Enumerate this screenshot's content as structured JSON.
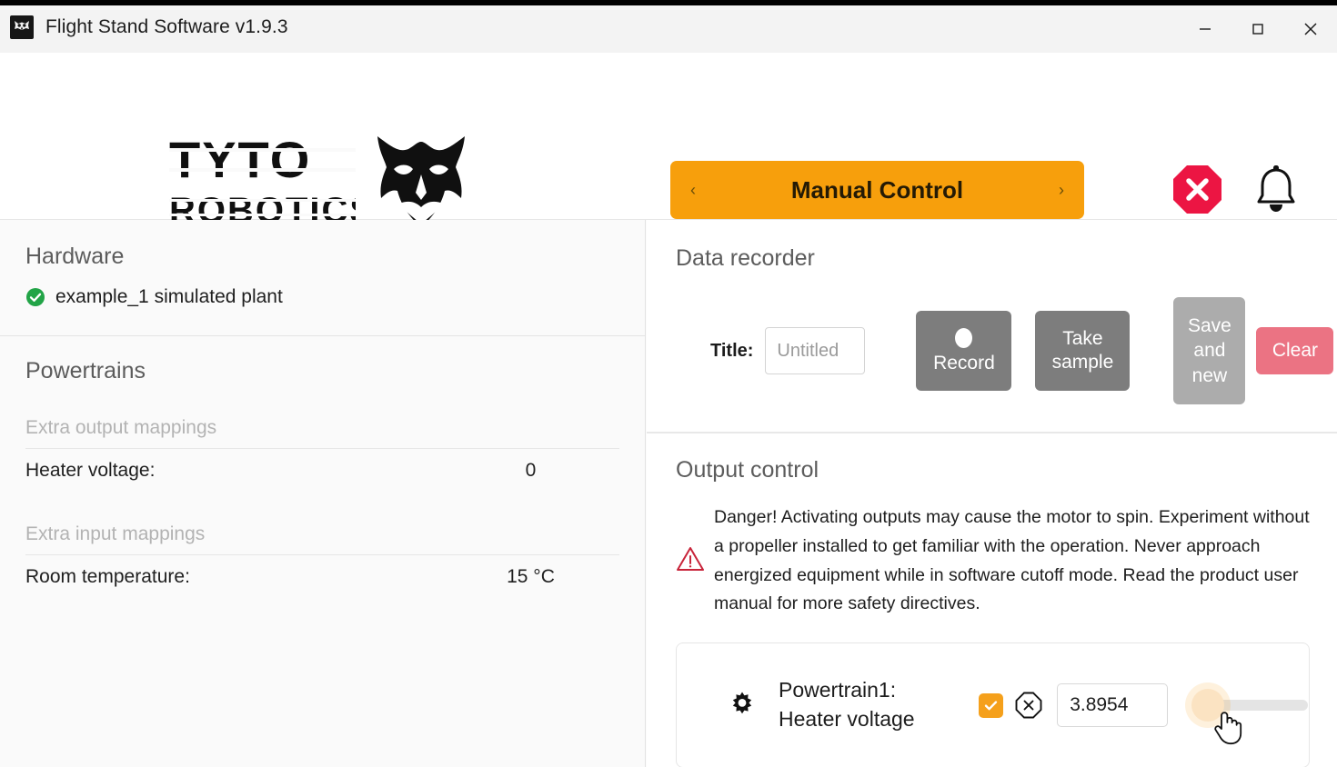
{
  "window": {
    "title": "Flight Stand Software v1.9.3",
    "app_icon": "owl-app-icon",
    "minimize_label": "Minimize",
    "maximize_label": "Maximize",
    "close_label": "Close"
  },
  "header": {
    "brand_line1": "TYTO",
    "brand_line2": "ROBOTICS",
    "brand_mark": "owl-logo",
    "mode": {
      "label": "Manual Control",
      "prev": "‹",
      "next": "›",
      "color": "#f79f0c"
    },
    "stop_button": {
      "name": "emergency-stop",
      "color": "#ec1543"
    },
    "bell_button": {
      "name": "notifications"
    }
  },
  "sidebar": {
    "hardware": {
      "title": "Hardware",
      "device": "example_1 simulated plant",
      "status_color": "#22a447"
    },
    "powertrains": {
      "title": "Powertrains",
      "groups": [
        {
          "title": "Extra output mappings",
          "rows": [
            {
              "label": "Heater voltage:",
              "value": "0"
            }
          ]
        },
        {
          "title": "Extra input mappings",
          "rows": [
            {
              "label": "Room temperature:",
              "value": "15 °C"
            }
          ]
        }
      ]
    }
  },
  "data_recorder": {
    "title": "Data recorder",
    "title_field_label": "Title:",
    "title_field_value": "",
    "title_field_placeholder": "Untitled",
    "record_label": "Record",
    "take_sample_label": "Take\nsample",
    "take_sample_line1": "Take",
    "take_sample_line2": "sample",
    "save_and_new_line1": "Save",
    "save_and_new_line2": "and",
    "save_and_new_line3": "new",
    "clear_label": "Clear",
    "clear_color": "#eb7383"
  },
  "output_control": {
    "title": "Output control",
    "warning_icon": "warning-triangle",
    "warning_color": "#c8243a",
    "warning_text": "Danger! Activating outputs may cause the motor to spin. Experiment without a propeller installed to get familiar with the operation. Never approach energized equipment while in software cutoff mode. Read the product user manual for more safety directives.",
    "powertrain_row": {
      "settings_icon": "gear-icon",
      "name_line1": "Powertrain1:",
      "name_line2": "Heater voltage",
      "enabled": true,
      "checkbox_color": "#f5a01b",
      "stop_icon": "octagon-x-icon",
      "value": "3.8954",
      "slider_value": 0,
      "slider_thumb_color": "#fbe3c2"
    }
  }
}
